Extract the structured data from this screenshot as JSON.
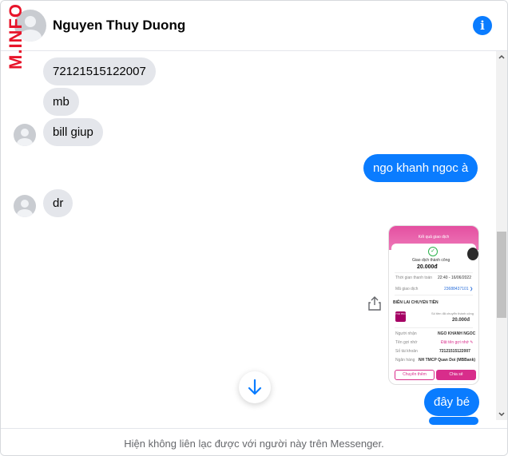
{
  "header": {
    "contact_name": "Nguyen Thuy Duong",
    "watermark": "M.INFO",
    "info_icon": "info-icon",
    "info_label": "i"
  },
  "messages": [
    {
      "direction": "in",
      "text": "72121515122007"
    },
    {
      "direction": "in",
      "text": "mb"
    },
    {
      "direction": "in",
      "text": "bill giup"
    },
    {
      "direction": "out",
      "text": "ngo khanh ngoc à"
    },
    {
      "direction": "in",
      "text": "dr"
    },
    {
      "direction": "out",
      "type": "image"
    },
    {
      "direction": "out",
      "text": "đây bé"
    }
  ],
  "receipt": {
    "header": "Kết quả giao dịch",
    "status": "Giao dịch thành công",
    "amount": "20.000đ",
    "time_label": "Thời gian thanh toán",
    "time_value": "22:40 - 16/06/2022",
    "tx_label": "Mã giao dịch",
    "tx_value": "23688437101 ❯",
    "section": "BIÊN LAI CHUYỂN TIỀN",
    "logo_text": "mo mo",
    "transfer_label": "Số tiền đã chuyển thành công",
    "transfer_amount": "20.000đ",
    "recipient_label": "Người nhận",
    "recipient_value": "NGO KHANH NGOC",
    "note_label": "Tên gợi nhớ",
    "note_value": "Đặt tên gợi nhớ ✎",
    "account_label": "Số tài khoản",
    "account_value": "72121515122007",
    "bank_label": "Ngân hàng",
    "bank_value": "NH TMCP Quan Doi (MBBank)",
    "btn_transfer_more": "Chuyển thêm",
    "btn_share": "Chia sẻ"
  },
  "footer": {
    "notice": "Hiện không liên lạc được với người này trên Messenger."
  },
  "colors": {
    "outgoing_bubble": "#0a7cff",
    "incoming_bubble": "#e4e6eb",
    "watermark": "#e8142a"
  }
}
